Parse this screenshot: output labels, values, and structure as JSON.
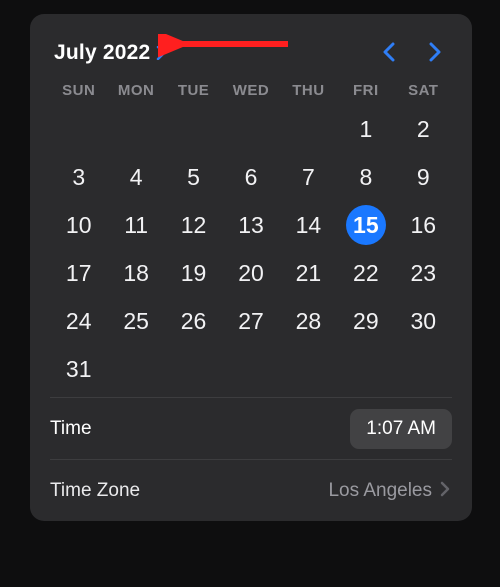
{
  "header": {
    "month_label": "July 2022"
  },
  "weekdays": [
    "SUN",
    "MON",
    "TUE",
    "WED",
    "THU",
    "FRI",
    "SAT"
  ],
  "calendar": {
    "leading_blanks": 5,
    "days_in_month": 31,
    "selected_day": 15
  },
  "time": {
    "label": "Time",
    "value": "1:07 AM"
  },
  "timezone": {
    "label": "Time Zone",
    "value": "Los Angeles"
  },
  "colors": {
    "accent": "#1a78ff"
  }
}
